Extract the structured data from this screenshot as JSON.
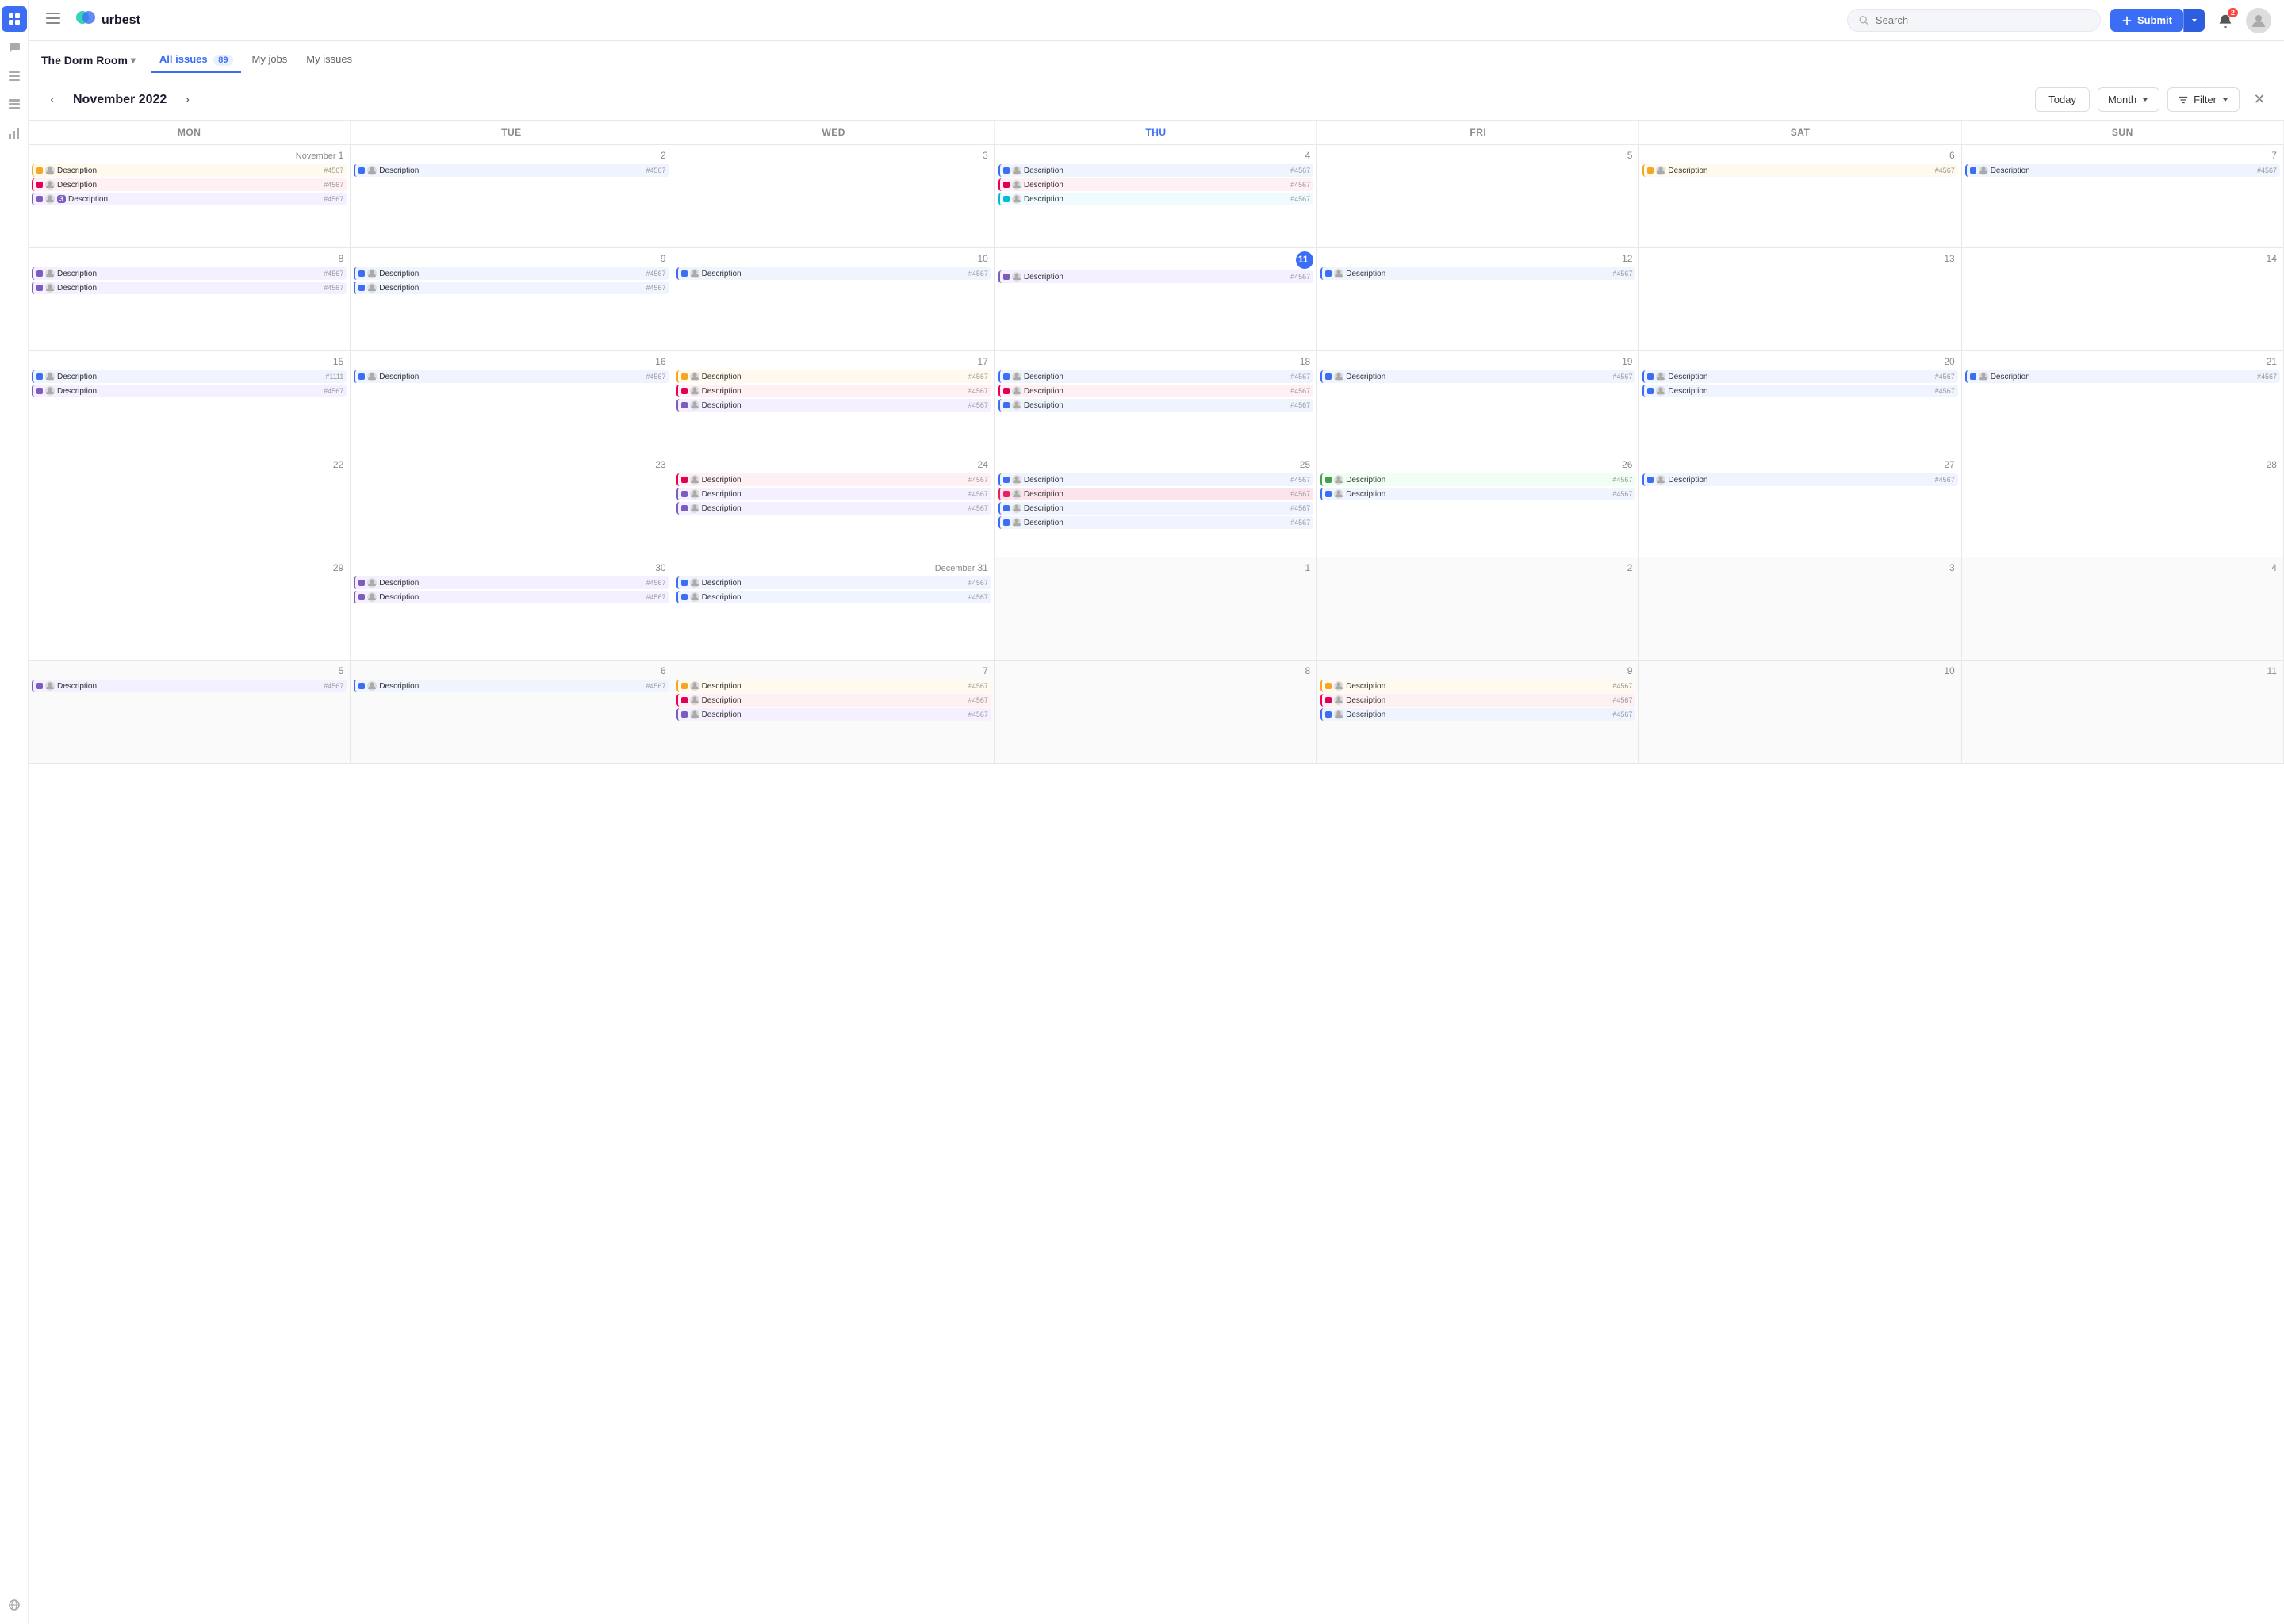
{
  "header": {
    "logo_text": "urbest",
    "search_placeholder": "Search",
    "submit_label": "Submit",
    "notif_count": "2",
    "hamburger_label": "Menu"
  },
  "sub_header": {
    "property": "The Dorm Room",
    "tabs": [
      {
        "label": "All issues",
        "badge": "89",
        "active": true
      },
      {
        "label": "My jobs",
        "active": false
      },
      {
        "label": "My issues",
        "active": false
      }
    ]
  },
  "cal_header": {
    "title": "November 2022",
    "prev": "‹",
    "next": "›",
    "today_label": "Today",
    "month_label": "Month",
    "filter_label": "Filter"
  },
  "day_headers": [
    "MON",
    "TUE",
    "WED",
    "THU",
    "FRI",
    "SAT",
    "SUN"
  ],
  "weeks": [
    {
      "days": [
        {
          "num": "1",
          "month_label": "November",
          "events": [
            {
              "color": "ev-yellow",
              "desc": "Description",
              "id": "#4567"
            },
            {
              "color": "ev-red",
              "desc": "Description",
              "id": "#4567"
            },
            {
              "color": "ev-purple",
              "desc": "Description",
              "id": "#4567",
              "badge": "3"
            }
          ]
        },
        {
          "num": "2",
          "events": [
            {
              "color": "ev-blue",
              "desc": "Description",
              "id": "#4567"
            }
          ]
        },
        {
          "num": "3",
          "events": []
        },
        {
          "num": "4",
          "events": [
            {
              "color": "ev-blue",
              "desc": "Description",
              "id": "#4567"
            },
            {
              "color": "ev-red",
              "desc": "Description",
              "id": "#4567"
            },
            {
              "color": "ev-teal",
              "desc": "Description",
              "id": "#4567"
            }
          ]
        },
        {
          "num": "5",
          "events": []
        },
        {
          "num": "6",
          "events": [
            {
              "color": "ev-yellow",
              "desc": "Description",
              "id": "#4567"
            }
          ]
        },
        {
          "num": "7",
          "events": [
            {
              "color": "ev-blue",
              "desc": "Description",
              "id": "#4567"
            }
          ]
        }
      ]
    },
    {
      "days": [
        {
          "num": "8",
          "events": [
            {
              "color": "ev-purple",
              "desc": "Description",
              "id": "#4567"
            },
            {
              "color": "ev-purple",
              "desc": "Description",
              "id": "#4567"
            }
          ]
        },
        {
          "num": "9",
          "events": [
            {
              "color": "ev-blue",
              "desc": "Description",
              "id": "#4567"
            },
            {
              "color": "ev-blue",
              "desc": "Description",
              "id": "#4567"
            }
          ]
        },
        {
          "num": "10",
          "events": [
            {
              "color": "ev-blue",
              "desc": "Description",
              "id": "#4567"
            }
          ]
        },
        {
          "num": "11",
          "today": true,
          "events": [
            {
              "color": "ev-purple",
              "desc": "Description",
              "id": "#4567"
            }
          ]
        },
        {
          "num": "12",
          "events": [
            {
              "color": "ev-blue",
              "desc": "Description",
              "id": "#4567"
            }
          ]
        },
        {
          "num": "13",
          "events": []
        },
        {
          "num": "14",
          "events": []
        }
      ]
    },
    {
      "days": [
        {
          "num": "15",
          "events": [
            {
              "color": "ev-blue",
              "desc": "Description",
              "id": "#1111"
            },
            {
              "color": "ev-purple",
              "desc": "Description",
              "id": "#4567"
            }
          ]
        },
        {
          "num": "16",
          "events": [
            {
              "color": "ev-blue",
              "desc": "Description",
              "id": "#4567"
            }
          ]
        },
        {
          "num": "17",
          "events": [
            {
              "color": "ev-yellow",
              "desc": "Description",
              "id": "#4567"
            },
            {
              "color": "ev-red",
              "desc": "Description",
              "id": "#4567"
            },
            {
              "color": "ev-purple",
              "desc": "Description",
              "id": "#4567"
            }
          ]
        },
        {
          "num": "18",
          "events": [
            {
              "color": "ev-blue",
              "desc": "Description",
              "id": "#4567"
            },
            {
              "color": "ev-red",
              "desc": "Description",
              "id": "#4567"
            },
            {
              "color": "ev-blue",
              "desc": "Description",
              "id": "#4567"
            }
          ]
        },
        {
          "num": "19",
          "events": [
            {
              "color": "ev-blue",
              "desc": "Description",
              "id": "#4567"
            }
          ]
        },
        {
          "num": "20",
          "events": [
            {
              "color": "ev-blue",
              "desc": "Description",
              "id": "#4567"
            },
            {
              "color": "ev-blue",
              "desc": "Description",
              "id": "#4567"
            }
          ]
        },
        {
          "num": "21",
          "events": [
            {
              "color": "ev-blue",
              "desc": "Description",
              "id": "#4567"
            }
          ]
        }
      ]
    },
    {
      "days": [
        {
          "num": "22",
          "events": []
        },
        {
          "num": "23",
          "events": []
        },
        {
          "num": "24",
          "events": [
            {
              "color": "ev-red",
              "desc": "Description",
              "id": "#4567"
            },
            {
              "color": "ev-purple",
              "desc": "Description",
              "id": "#4567"
            },
            {
              "color": "ev-purple",
              "desc": "Description",
              "id": "#4567"
            }
          ]
        },
        {
          "num": "25",
          "events": [
            {
              "color": "ev-blue",
              "desc": "Description",
              "id": "#4567"
            },
            {
              "color": "ev-pink",
              "desc": "Description",
              "id": "#4567"
            },
            {
              "color": "ev-blue",
              "desc": "Description",
              "id": "#4567"
            },
            {
              "color": "ev-blue",
              "desc": "Description",
              "id": "#4567"
            }
          ]
        },
        {
          "num": "26",
          "events": [
            {
              "color": "ev-green",
              "desc": "Description",
              "id": "#4567"
            },
            {
              "color": "ev-blue",
              "desc": "Description",
              "id": "#4567"
            }
          ]
        },
        {
          "num": "27",
          "events": [
            {
              "color": "ev-blue",
              "desc": "Description",
              "id": "#4567"
            }
          ]
        },
        {
          "num": "28",
          "events": []
        }
      ]
    },
    {
      "days": [
        {
          "num": "29",
          "events": []
        },
        {
          "num": "30",
          "events": [
            {
              "color": "ev-purple",
              "desc": "Description",
              "id": "#4567"
            },
            {
              "color": "ev-purple",
              "desc": "Description",
              "id": "#4567"
            }
          ]
        },
        {
          "num": "31",
          "month_label": "December",
          "events": [
            {
              "color": "ev-blue",
              "desc": "Description",
              "id": "#4567"
            },
            {
              "color": "ev-blue",
              "desc": "Description",
              "id": "#4567"
            }
          ]
        },
        {
          "num": "1",
          "other_month": true,
          "events": []
        },
        {
          "num": "2",
          "other_month": true,
          "events": []
        },
        {
          "num": "3",
          "other_month": true,
          "events": []
        },
        {
          "num": "4",
          "other_month": true,
          "events": []
        }
      ]
    },
    {
      "days": [
        {
          "num": "5",
          "other_month": true,
          "events": [
            {
              "color": "ev-purple",
              "desc": "Description",
              "id": "#4567"
            }
          ]
        },
        {
          "num": "6",
          "other_month": true,
          "events": [
            {
              "color": "ev-blue",
              "desc": "Description",
              "id": "#4567"
            }
          ]
        },
        {
          "num": "7",
          "other_month": true,
          "events": [
            {
              "color": "ev-yellow",
              "desc": "Description",
              "id": "#4567"
            },
            {
              "color": "ev-red",
              "desc": "Description",
              "id": "#4567"
            },
            {
              "color": "ev-purple",
              "desc": "Description",
              "id": "#4567"
            }
          ]
        },
        {
          "num": "8",
          "other_month": true,
          "events": []
        },
        {
          "num": "9",
          "other_month": true,
          "events": [
            {
              "color": "ev-yellow",
              "desc": "Description",
              "id": "#4567"
            },
            {
              "color": "ev-red",
              "desc": "Description",
              "id": "#4567"
            },
            {
              "color": "ev-blue",
              "desc": "Description",
              "id": "#4567"
            }
          ]
        },
        {
          "num": "10",
          "other_month": true,
          "events": []
        },
        {
          "num": "11",
          "other_month": true,
          "events": []
        }
      ]
    }
  ],
  "nav_icons": [
    {
      "name": "grid-icon",
      "active": true,
      "symbol": "⊞"
    },
    {
      "name": "chat-icon",
      "active": false,
      "symbol": "💬"
    },
    {
      "name": "list-icon",
      "active": false,
      "symbol": "☰"
    },
    {
      "name": "table-icon",
      "active": false,
      "symbol": "⊟"
    },
    {
      "name": "chart-icon",
      "active": false,
      "symbol": "📊"
    },
    {
      "name": "globe-icon",
      "active": false,
      "symbol": "🌐"
    }
  ]
}
